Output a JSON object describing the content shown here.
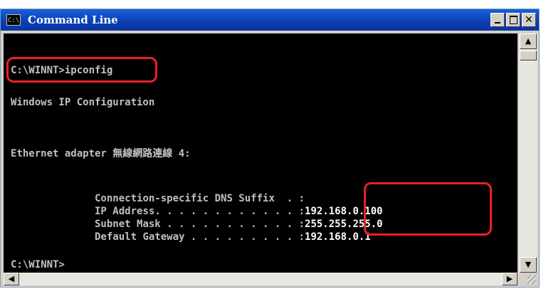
{
  "window": {
    "title": "Command Line",
    "app_icon": "C:\\"
  },
  "console": {
    "prompt_command": "C:\\WINNT>ipconfig",
    "header": "Windows IP Configuration",
    "adapter": "Ethernet adapter 無線網路連線 4:",
    "rows": [
      {
        "label": "        Connection-specific DNS Suffix  . :",
        "value": ""
      },
      {
        "label": "        IP Address. . . . . . . . . . . . :",
        "value": "192.168.0.100"
      },
      {
        "label": "        Subnet Mask . . . . . . . . . . . :",
        "value": "255.255.255.0"
      },
      {
        "label": "        Default Gateway . . . . . . . . . :",
        "value": "192.168.0.1"
      }
    ],
    "final_prompt": "C:\\WINNT>"
  },
  "colors": {
    "console_bg": "#000000",
    "console_text": "#c0c0c0",
    "highlight": "#e8202a",
    "titlebar": "#0a3fb3"
  },
  "icons": [
    "app-icon",
    "minimize-icon",
    "maximize-icon",
    "close-icon",
    "scroll-up-icon",
    "scroll-down-icon",
    "scroll-left-icon",
    "scroll-right-icon",
    "resize-grip-icon"
  ]
}
